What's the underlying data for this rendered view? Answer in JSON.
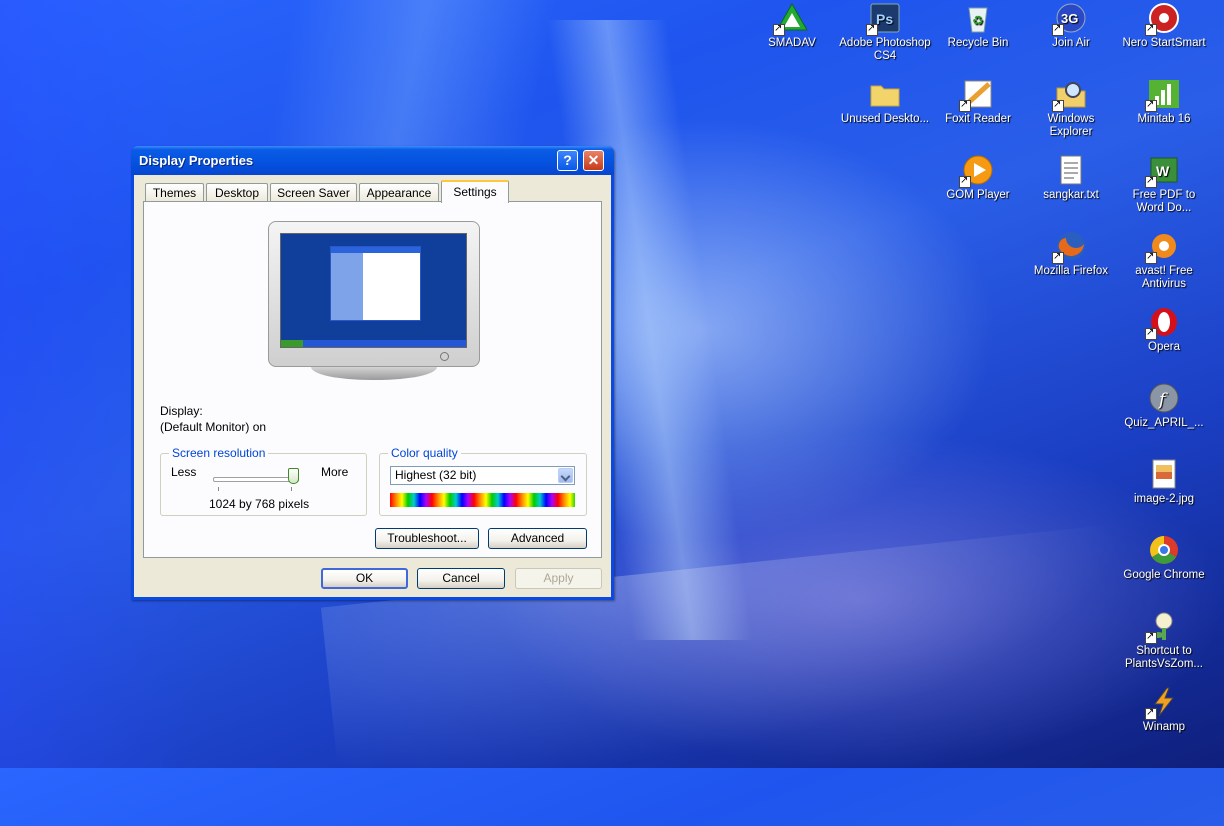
{
  "desktop": {
    "icons": [
      {
        "label": "SMADAV",
        "glyph": "▲",
        "color": "#22aa33"
      },
      {
        "label": "Adobe Photoshop CS4",
        "glyph": "Ps",
        "color": "#1d3a6e"
      },
      {
        "label": "Recycle Bin",
        "glyph": "♻",
        "color": "#d8e8f0"
      },
      {
        "label": "Join Air",
        "glyph": "3G",
        "color": "#2a49c8"
      },
      {
        "label": "Nero StartSmart",
        "glyph": "◉",
        "color": "#cc2222"
      },
      {
        "label": "Unused Deskto...",
        "glyph": "",
        "color": "#f3d46a"
      },
      {
        "label": "Foxit Reader",
        "glyph": "✎",
        "color": "#e8a030"
      },
      {
        "label": "Windows Explorer",
        "glyph": "🔍",
        "color": "#f1d06c"
      },
      {
        "label": "Minitab 16",
        "glyph": "▮",
        "color": "#55b232"
      },
      {
        "label": "GOM Player",
        "glyph": "▶",
        "color": "#f59a12"
      },
      {
        "label": "sangkar.txt",
        "glyph": "≡",
        "color": "#ffffff"
      },
      {
        "label": "Free PDF to Word Do...",
        "glyph": "W",
        "color": "#3a8f3a"
      },
      {
        "label": "Mozilla Firefox",
        "glyph": "◍",
        "color": "#e66a1a"
      },
      {
        "label": "avast! Free Antivirus",
        "glyph": "✺",
        "color": "#f08a1c"
      },
      {
        "label": "Opera",
        "glyph": "O",
        "color": "#d4101a"
      },
      {
        "label": "Quiz_APRIL_...",
        "glyph": "ƒ",
        "color": "#707c8c"
      },
      {
        "label": "image-2.jpg",
        "glyph": "▣",
        "color": "#f0c060"
      },
      {
        "label": "Google Chrome",
        "glyph": "◎",
        "color": "#3c9c3c"
      },
      {
        "label": "Shortcut to PlantsVsZom...",
        "glyph": "✿",
        "color": "#5aa84a"
      },
      {
        "label": "Winamp",
        "glyph": "⚡",
        "color": "#f0a020"
      }
    ]
  },
  "dialog": {
    "title": "Display Properties",
    "help_glyph": "?",
    "close_glyph": "✕",
    "tabs": [
      "Themes",
      "Desktop",
      "Screen Saver",
      "Appearance",
      "Settings"
    ],
    "active_tab": "Settings",
    "display_label": "Display:",
    "display_value": "(Default Monitor) on",
    "screen_resolution": {
      "title": "Screen resolution",
      "less_label": "Less",
      "more_label": "More",
      "value_text": "1024 by 768 pixels",
      "slider_position": 0.95
    },
    "color_quality": {
      "title": "Color quality",
      "selected": "Highest (32 bit)"
    },
    "buttons": {
      "troubleshoot": "Troubleshoot...",
      "advanced": "Advanced",
      "ok": "OK",
      "cancel": "Cancel",
      "apply": "Apply"
    }
  }
}
